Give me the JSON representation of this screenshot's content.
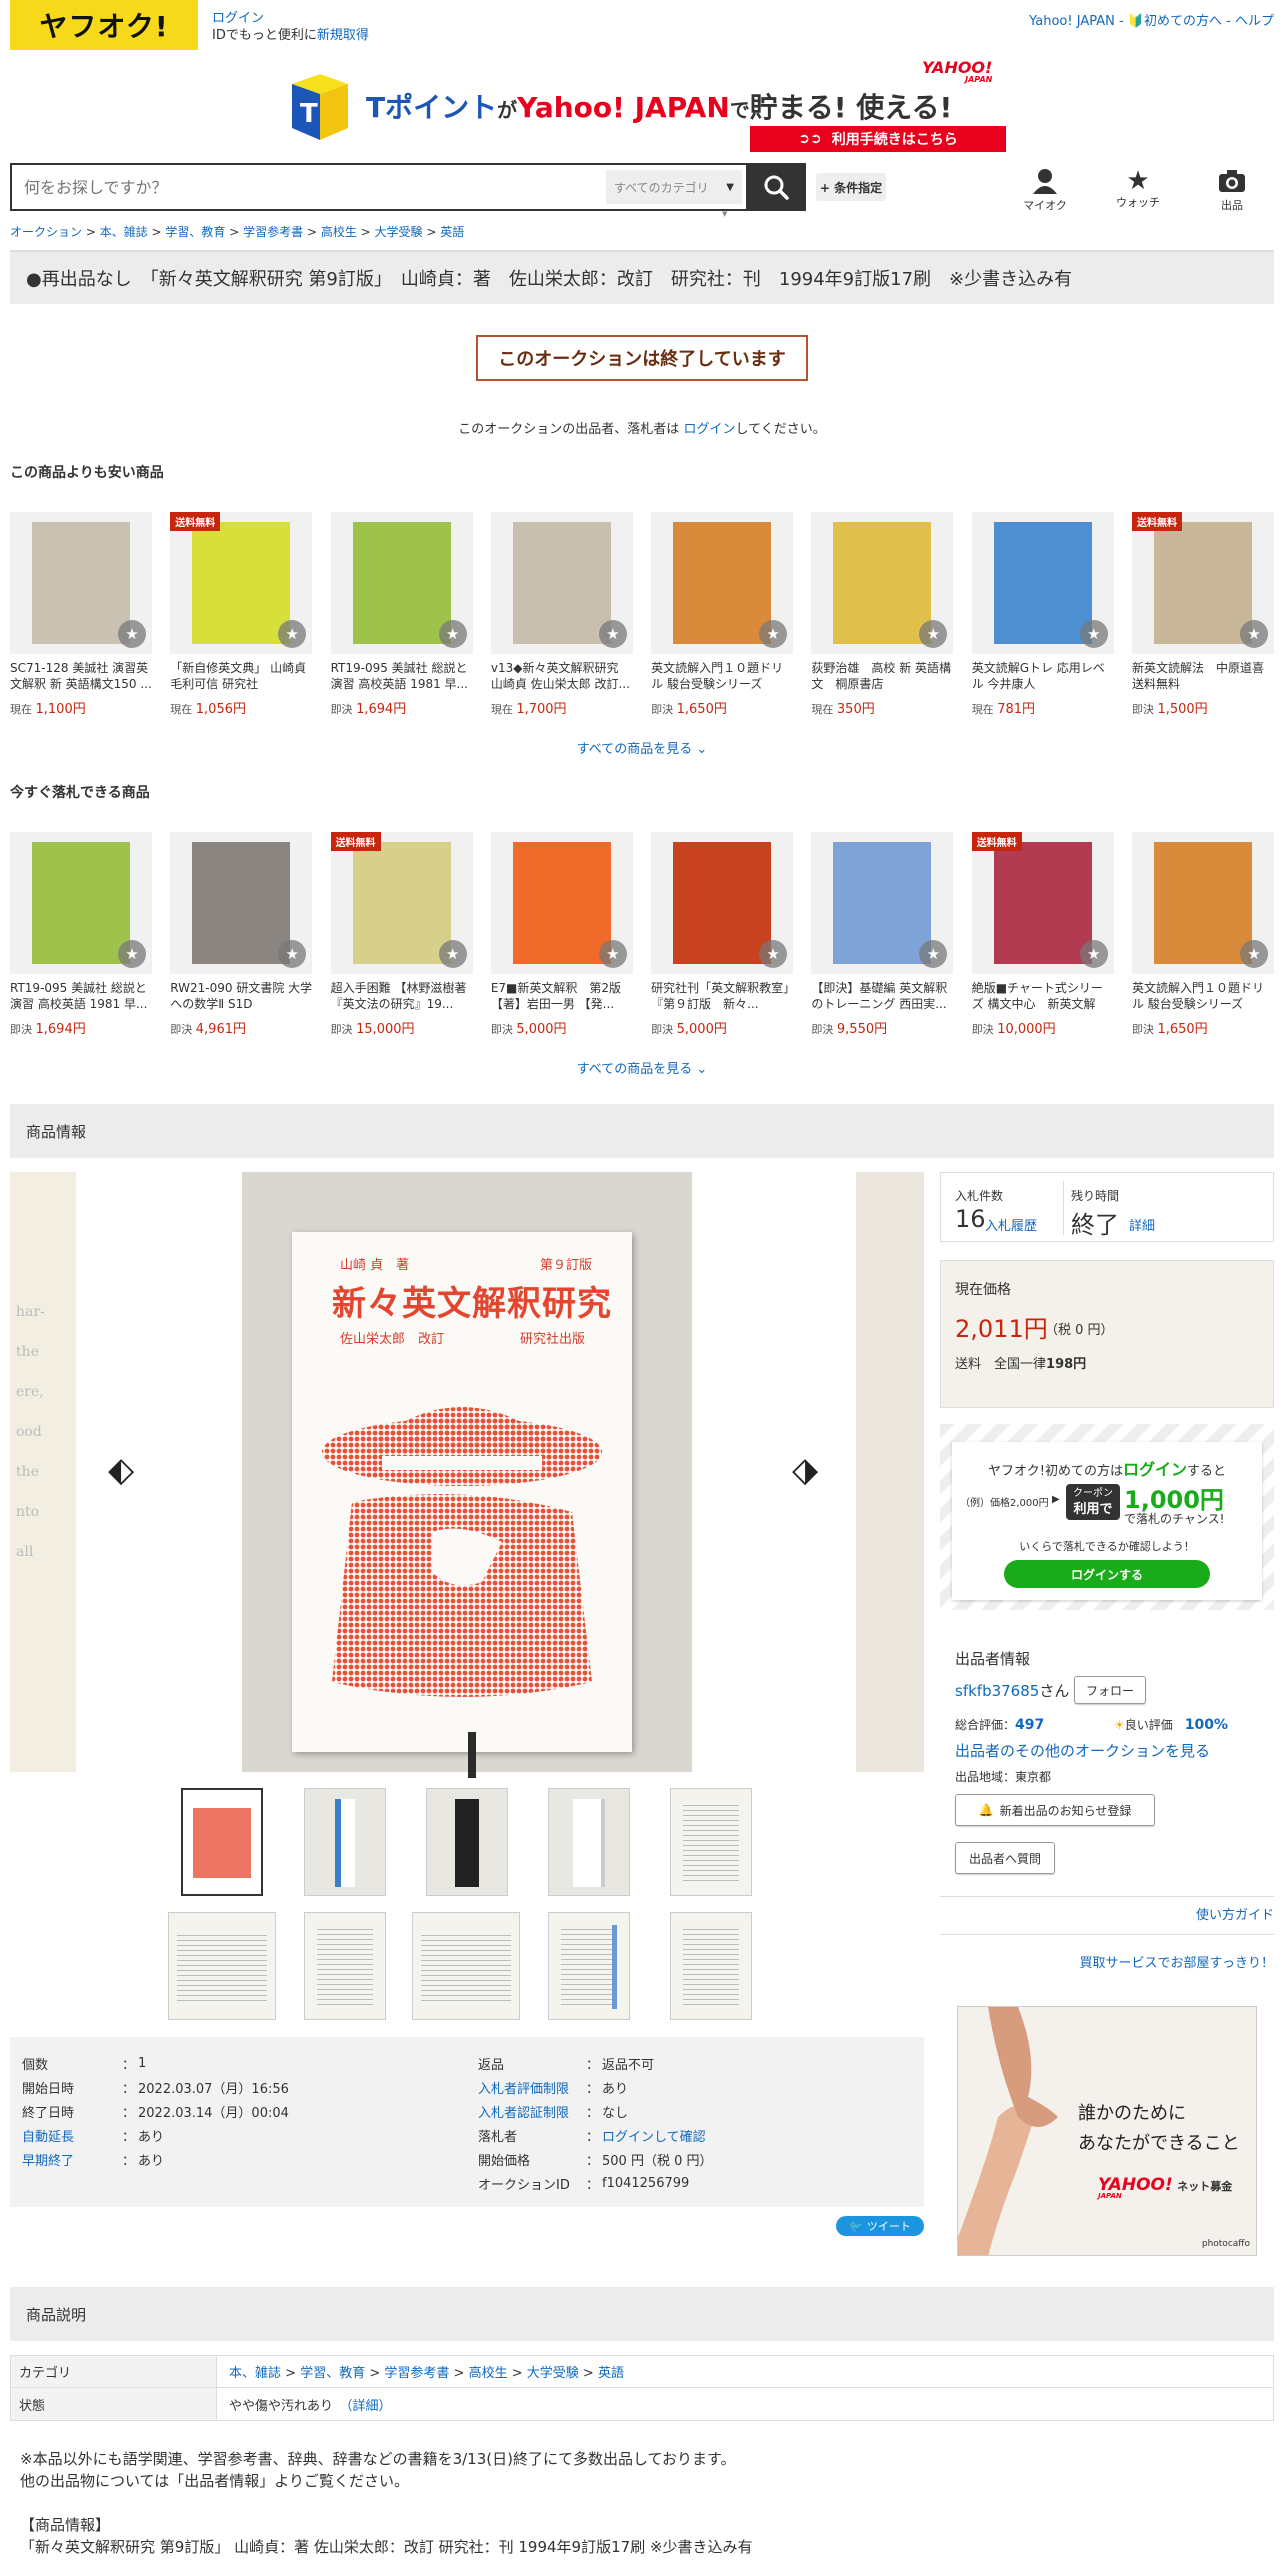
{
  "header": {
    "logo": "ヤフオク!",
    "login": "ログイン",
    "subtext_prefix": "IDでもっと便利に",
    "signup": "新規取得",
    "yahoo_japan": "Yahoo! JAPAN",
    "first_time": "初めての方へ",
    "help": "ヘルプ"
  },
  "banner": {
    "line1_a": "Tポイント",
    "line1_b": "が",
    "line1_c": "Yahoo! JAPAN",
    "line1_d": "で",
    "line1_e": "貯まる! 使える!",
    "logo": "YAHOO!",
    "logo_sub": "JAPAN",
    "cta": "利用手続きはこちら"
  },
  "search": {
    "placeholder": "何をお探しですか？",
    "category": "すべてのカテゴリ",
    "conditions": "+ 条件指定"
  },
  "nav_icons": [
    {
      "label": "マイオク"
    },
    {
      "label": "ウォッチ"
    },
    {
      "label": "出品"
    }
  ],
  "breadcrumb": [
    "オークション",
    "本、雑誌",
    "学習、教育",
    "学習参考書",
    "高校生",
    "大学受験",
    "英語"
  ],
  "title": "●再出品なし　「新々英文解釈研究 第9訂版」　山崎貞：著　佐山栄太郎：改訂　研究社：刊　1994年9訂版17刷　※少書き込み有",
  "ended_notice": "このオークションは終了しています",
  "ended_note_prefix": "このオークションの出品者、落札者は",
  "ended_note_link": "ログイン",
  "ended_note_suffix": "してください。",
  "cheaper": {
    "heading": "この商品よりも安い商品",
    "see_all": "すべての商品を見る",
    "items": [
      {
        "title": "SC71-128 美誠社 演習英文解釈 新 英語構文150 ...",
        "price_label": "現在",
        "price": "1,100円",
        "badge": "",
        "color": "#c9c2b2"
      },
      {
        "title": "「新自修英文典」 山崎貞 毛利可信 研究社",
        "price_label": "現在",
        "price": "1,056円",
        "badge": "送料無料",
        "color": "#d7e03a"
      },
      {
        "title": "RT19-095 美誠社 総説と演習 高校英語 1981 早...",
        "price_label": "即決",
        "price": "1,694円",
        "badge": "",
        "color": "#9fc24a"
      },
      {
        "title": "v13◆新々英文解釈研究 山崎貞 佐山栄太郎 改訂...",
        "price_label": "現在",
        "price": "1,700円",
        "badge": "",
        "color": "#c8bfae"
      },
      {
        "title": "英文読解入門１０題ドリル 駿台受験シリーズ",
        "price_label": "即決",
        "price": "1,650円",
        "badge": "",
        "color": "#d98a3a"
      },
      {
        "title": "荻野治雄　高校 新 英語構文　桐原書店",
        "price_label": "現在",
        "price": "350円",
        "badge": "",
        "color": "#e0c04a"
      },
      {
        "title": "英文読解Gトレ 応用レベル 今井康人",
        "price_label": "現在",
        "price": "781円",
        "badge": "",
        "color": "#4d8fd0"
      },
      {
        "title": "新英文読解法　中原道喜 送料無料",
        "price_label": "即決",
        "price": "1,500円",
        "badge": "送料無料",
        "color": "#c9b79a"
      }
    ]
  },
  "instant": {
    "heading": "今すぐ落札できる商品",
    "see_all": "すべての商品を見る",
    "items": [
      {
        "title": "RT19-095 美誠社 総説と演習 高校英語 1981 早...",
        "price_label": "即決",
        "price": "1,694円",
        "badge": "",
        "color": "#9fc24a"
      },
      {
        "title": "RW21-090 研文書院 大学への数学Ⅱ S1D",
        "price_label": "即決",
        "price": "4,961円",
        "badge": "",
        "color": "#8a8580"
      },
      {
        "title": "超入手困難 【林野滋樹著『英文法の研究』19...",
        "price_label": "即決",
        "price": "15,000円",
        "badge": "送料無料",
        "color": "#d6d08a"
      },
      {
        "title": "E7■新英文解釈　第2版 【著】岩田一男 【発...",
        "price_label": "即決",
        "price": "5,000円",
        "badge": "",
        "color": "#f06a2a"
      },
      {
        "title": "研究社刊「英文解釈教室」『第９訂版　新々...",
        "price_label": "即決",
        "price": "5,000円",
        "badge": "",
        "color": "#c7421f"
      },
      {
        "title": "【即決】基礎編 英文解釈のトレーニング 西田実...",
        "price_label": "即決",
        "price": "9,550円",
        "badge": "",
        "color": "#7fa3d6"
      },
      {
        "title": "絶版■チャート式シリーズ 構文中心　新英文解釈...",
        "price_label": "即決",
        "price": "10,000円",
        "badge": "送料無料",
        "color": "#b23b52"
      },
      {
        "title": "英文読解入門１０題ドリル 駿台受験シリーズ",
        "price_label": "即決",
        "price": "1,650円",
        "badge": "",
        "color": "#d98a3a"
      }
    ]
  },
  "product_info": {
    "heading": "商品情報",
    "book_author": "山崎 貞　著",
    "book_edition": "第９訂版",
    "book_title": "新々英文解釈研究",
    "book_reviser": "佐山栄太郎　改訂",
    "book_publisher": "研究社出版",
    "bid_count_label": "入札件数",
    "bid_count": "16",
    "bid_history": "入札履歴",
    "time_left_label": "残り時間",
    "time_left": "終了",
    "detail": "詳細",
    "current_price_label": "現在価格",
    "current_price": "2,011円",
    "tax": "（税 0 円）",
    "shipping_label": "送料",
    "shipping_prefix": "全国一律",
    "shipping": "198円",
    "promo_line1_a": "ヤフオク!初めての方は",
    "promo_line1_b": "ログイン",
    "promo_line1_c": "すると",
    "promo_example": "（例）価格2,000円",
    "promo_coupon": "クーポン",
    "promo_use": "利用で",
    "promo_amount": "1,000円",
    "promo_chance": "で落札のチャンス!",
    "promo_note": "いくらで落札できるか確認しよう！",
    "promo_button": "ログインする",
    "seller_heading": "出品者情報",
    "seller_id": "sfkfb37685",
    "seller_suffix": "さん",
    "follow": "フォロー",
    "rating_label": "総合評価：",
    "rating": "497",
    "good_label": "良い評価",
    "good_pct": "100%",
    "other_auctions": "出品者のその他のオークションを見る",
    "region": "出品地域：東京都",
    "new_listing": "新着出品のお知らせ登録",
    "question": "出品者へ質問",
    "guide": "使い方ガイド",
    "buy_service": "買取サービスでお部屋すっきり！",
    "ad_line1": "誰かのために",
    "ad_line2": "あなたができること",
    "ad_logo": "YAHOO!",
    "ad_logo_sub": "JAPAN",
    "ad_tag": "ネット募金",
    "ad_credit": "photocaffo"
  },
  "details_left": [
    {
      "k": "個数",
      "v": "1",
      "link": false
    },
    {
      "k": "開始日時",
      "v": "2022.03.07（月）16:56",
      "link": false
    },
    {
      "k": "終了日時",
      "v": "2022.03.14（月）00:04",
      "link": false
    },
    {
      "k": "自動延長",
      "v": "あり",
      "link": true
    },
    {
      "k": "早期終了",
      "v": "あり",
      "link": true
    }
  ],
  "details_right": [
    {
      "k": "返品",
      "v": "返品不可",
      "link": false,
      "vlink": false
    },
    {
      "k": "入札者評価制限",
      "v": "あり",
      "link": true,
      "vlink": false
    },
    {
      "k": "入札者認証制限",
      "v": "なし",
      "link": true,
      "vlink": false
    },
    {
      "k": "落札者",
      "v": "ログインして確認",
      "link": false,
      "vlink": true
    },
    {
      "k": "開始価格",
      "v": "500 円（税 0 円）",
      "link": false,
      "vlink": false
    },
    {
      "k": "オークションID",
      "v": "f1041256799",
      "link": false,
      "vlink": false
    }
  ],
  "tweet": "ツイート",
  "description": {
    "heading": "商品説明",
    "category_label": "カテゴリ",
    "category_path": [
      "本、雑誌",
      "学習、教育",
      "学習参考書",
      "高校生",
      "大学受験",
      "英語"
    ],
    "state_label": "状態",
    "state": "やや傷や汚れあり",
    "state_detail": "（詳細）",
    "line1": "※本品以外にも語学関連、学習参考書、辞典、辞書などの書籍を3/13(日)終了にて多数出品しております。",
    "line2": "他の出品物については「出品者情報」よりご覧ください。",
    "line3": "【商品情報】",
    "line4": "「新々英文解釈研究 第9訂版」 山崎貞：著 佐山栄太郎：改訂 研究社：刊 1994年9訂版17刷 ※少書き込み有"
  },
  "colors": {
    "accent": "#1068bf",
    "price": "#c7250d",
    "logo_bg": "#f5d91a",
    "green": "#1aab1a"
  }
}
